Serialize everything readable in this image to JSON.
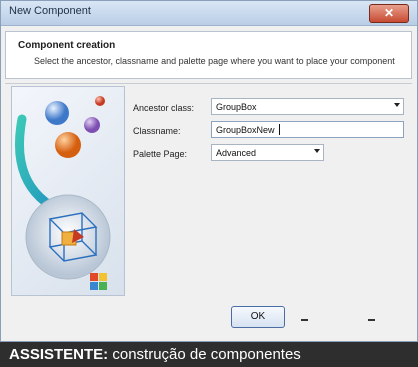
{
  "window": {
    "title": "New Component",
    "close_glyph": "✕"
  },
  "header": {
    "title": "Component creation",
    "description": "Select the ancestor, classname and palette page where you want to place your component"
  },
  "form": {
    "ancestor_label": "Ancestor class:",
    "ancestor_value": "GroupBox",
    "classname_label": "Classname:",
    "classname_value": "GroupBoxNew",
    "palette_label": "Palette Page:",
    "palette_value": "Advanced"
  },
  "buttons": {
    "ok_label": "OK"
  },
  "caption": {
    "bold": "ASSISTENTE:",
    "text": " construção de componentes"
  }
}
